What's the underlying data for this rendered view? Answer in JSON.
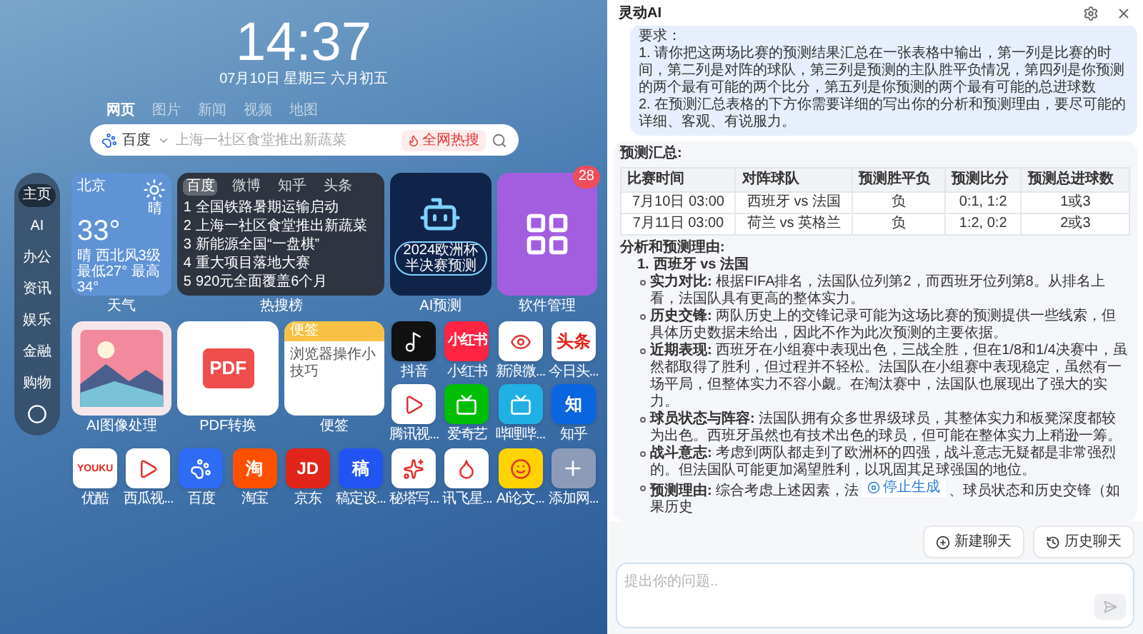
{
  "desktop": {
    "clock": "14:37",
    "date": "07月10日 星期三 六月初五",
    "search_tabs": [
      {
        "label": "网页",
        "selected": true
      },
      {
        "label": "图片",
        "selected": false
      },
      {
        "label": "新闻",
        "selected": false
      },
      {
        "label": "视频",
        "selected": false
      },
      {
        "label": "地图",
        "selected": false
      }
    ],
    "search": {
      "engine": "百度",
      "placeholder": "上海一社区食堂推出新蔬菜",
      "hot_button": "全网热搜"
    },
    "sidebar": [
      {
        "label": "主页",
        "selected": true
      },
      {
        "label": "AI",
        "selected": false
      },
      {
        "label": "办公",
        "selected": false
      },
      {
        "label": "资讯",
        "selected": false
      },
      {
        "label": "娱乐",
        "selected": false
      },
      {
        "label": "金融",
        "selected": false
      },
      {
        "label": "购物",
        "selected": false
      }
    ],
    "weather": {
      "city": "北京",
      "temperature": "33°",
      "condition": "晴",
      "wind": "晴 西北风3级",
      "range": "最低27° 最高34°",
      "caption": "天气"
    },
    "hot_list": {
      "tabs": [
        {
          "label": "百度",
          "selected": true
        },
        {
          "label": "微博",
          "selected": false
        },
        {
          "label": "知乎",
          "selected": false
        },
        {
          "label": "头条",
          "selected": false
        }
      ],
      "items": [
        {
          "rank": "1",
          "title": "全国铁路暑期运输启动"
        },
        {
          "rank": "2",
          "title": "上海一社区食堂推出新蔬菜"
        },
        {
          "rank": "3",
          "title": "新能源全国“一盘棋”"
        },
        {
          "rank": "4",
          "title": "重大项目落地大赛"
        },
        {
          "rank": "5",
          "title": "920元全面覆盖6个月"
        }
      ],
      "caption": "热搜榜"
    },
    "ai_card": {
      "banner": "2024欧洲杯半决赛预测",
      "caption": "AI预测"
    },
    "software": {
      "badge": "28",
      "caption": "软件管理"
    },
    "image_tile": {
      "caption": "AI图像处理"
    },
    "pdf_tile": {
      "glyph": "PDF",
      "caption": "PDF转换"
    },
    "note": {
      "header": "便签",
      "body": "浏览器操作小技巧",
      "caption": "便签"
    },
    "apps": [
      {
        "label": "抖音",
        "kind": "icon",
        "color": "#111111"
      },
      {
        "label": "小红书",
        "kind": "glyph",
        "glyph": "小红书",
        "color": "#ff2442"
      },
      {
        "label": "新浪微...",
        "kind": "icon",
        "color": "#ffffff"
      },
      {
        "label": "今日头...",
        "kind": "glyph",
        "glyph": "头条",
        "color": "#ffffff"
      },
      {
        "label": "腾讯视...",
        "kind": "icon",
        "color": "#ffffff"
      },
      {
        "label": "爱奇艺",
        "kind": "icon",
        "color": "#00be06"
      },
      {
        "label": "哔哩哔...",
        "kind": "icon",
        "color": "#20b0e3"
      },
      {
        "label": "知乎",
        "kind": "glyph",
        "glyph": "知",
        "color": "#0a66e0"
      }
    ],
    "dock": [
      {
        "label": "优酷",
        "kind": "glyph",
        "glyph": "YOUKU",
        "color": "#ffffff"
      },
      {
        "label": "西瓜视...",
        "kind": "icon",
        "color": "#ffffff"
      },
      {
        "label": "百度",
        "kind": "icon",
        "color": "#2e6cf6"
      },
      {
        "label": "淘宝",
        "kind": "glyph",
        "glyph": "淘",
        "color": "#ff5000"
      },
      {
        "label": "京东",
        "kind": "glyph",
        "glyph": "JD",
        "color": "#e1251b"
      },
      {
        "label": "稿定设...",
        "kind": "glyph",
        "glyph": "稿",
        "color": "#2254f4"
      },
      {
        "label": "秘塔写...",
        "kind": "icon",
        "color": "#ffffff"
      },
      {
        "label": "讯飞星...",
        "kind": "icon",
        "color": "#ffffff"
      },
      {
        "label": "AI论文...",
        "kind": "icon",
        "color": "#ffd200"
      },
      {
        "label": "添加网...",
        "kind": "add",
        "color": "#8c9cb8"
      }
    ]
  },
  "assistant": {
    "title": "灵动AI",
    "user_message": [
      "要求：",
      "1. 请你把这两场比赛的预测结果汇总在一张表格中输出，第一列是比赛的时间，第二列是对阵的球队，第三列是预测的主队胜平负情况，第四列是你预测的两个最有可能的两个比分，第五列是你预测的两个最有可能的总进球数",
      "2. 在预测汇总表格的下方你需要详细的写出你的分析和预测理由，要尽可能的详细、客观、有说服力。"
    ],
    "table_title": "预测汇总:",
    "table": {
      "columns": [
        "比赛时间",
        "对阵球队",
        "预测胜平负",
        "预测比分",
        "预测总进球数"
      ],
      "rows": [
        [
          "7月10日 03:00",
          "西班牙 vs 法国",
          "负",
          "0:1, 1:2",
          "1或3"
        ],
        [
          "7月11日 03:00",
          "荷兰 vs 英格兰",
          "负",
          "1:2, 0:2",
          "2或3"
        ]
      ]
    },
    "analysis_title": "分析和预测理由:",
    "sections": [
      {
        "number": "1.",
        "title": "西班牙 vs 法国",
        "points": [
          {
            "label": "实力对比:",
            "text": "根据FIFA排名，法国队位列第2，而西班牙位列第8。从排名上看，法国队具有更高的整体实力。"
          },
          {
            "label": "历史交锋:",
            "text": "两队历史上的交锋记录可能为这场比赛的预测提供一些线索，但具体历史数据未给出，因此不作为此次预测的主要依据。"
          },
          {
            "label": "近期表现:",
            "text": "西班牙在小组赛中表现出色，三战全胜，但在1/8和1/4决赛中，虽然都取得了胜利，但过程并不轻松。法国队在小组赛中表现稳定，虽然有一场平局，但整体实力不容小觑。在淘汰赛中，法国队也展现出了强大的实力。"
          },
          {
            "label": "球员状态与阵容:",
            "text": "法国队拥有众多世界级球员，其整体实力和板凳深度都较为出色。西班牙虽然也有技术出色的球员，但可能在整体实力上稍逊一筹。"
          },
          {
            "label": "战斗意志:",
            "text": "考虑到两队都走到了欧洲杯的四强，战斗意志无疑都是非常强烈的。但法国队可能更加渴望胜利，以巩固其足球强国的地位。"
          },
          {
            "label": "预测理由:",
            "text": "综合考虑上述因素，法",
            "text_after": "、球员状态和历史交锋（如果历史"
          }
        ]
      }
    ],
    "stop_button": "停止生成",
    "buttons": [
      "新建聊天",
      "历史聊天"
    ],
    "input": {
      "placeholder": "提出你的问题.."
    },
    "send_disabled": true
  }
}
